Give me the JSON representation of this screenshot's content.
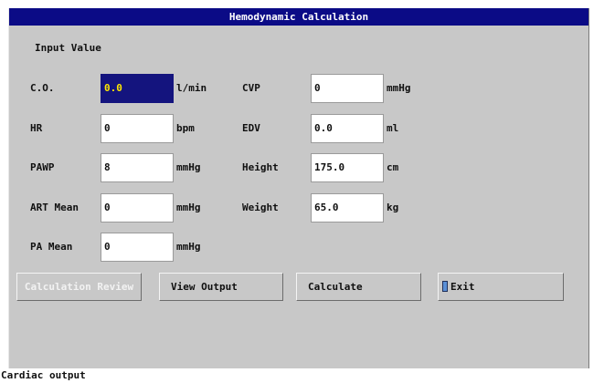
{
  "window": {
    "title": "Hemodynamic Calculation"
  },
  "section_label": "Input Value",
  "fields": {
    "co": {
      "label": "C.O.",
      "value": "0.0",
      "unit": "l/min"
    },
    "hr": {
      "label": "HR",
      "value": "0",
      "unit": "bpm"
    },
    "pawp": {
      "label": "PAWP",
      "value": "8",
      "unit": "mmHg"
    },
    "art_mean": {
      "label": "ART Mean",
      "value": "0",
      "unit": "mmHg"
    },
    "pa_mean": {
      "label": "PA Mean",
      "value": "0",
      "unit": "mmHg"
    },
    "cvp": {
      "label": "CVP",
      "value": "0",
      "unit": "mmHg"
    },
    "edv": {
      "label": "EDV",
      "value": "0.0",
      "unit": "ml"
    },
    "height": {
      "label": "Height",
      "value": "175.0",
      "unit": "cm"
    },
    "weight": {
      "label": "Weight",
      "value": "65.0",
      "unit": "kg"
    }
  },
  "buttons": {
    "calculation_review": "Calculation Review",
    "view_output": "View Output",
    "calculate": "Calculate",
    "exit": "Exit"
  },
  "status": {
    "text": "Cardiac output"
  },
  "colors": {
    "title_bar": "#0b0b86",
    "focused_field_bg": "#14147e",
    "focused_field_text": "#ffe800"
  }
}
